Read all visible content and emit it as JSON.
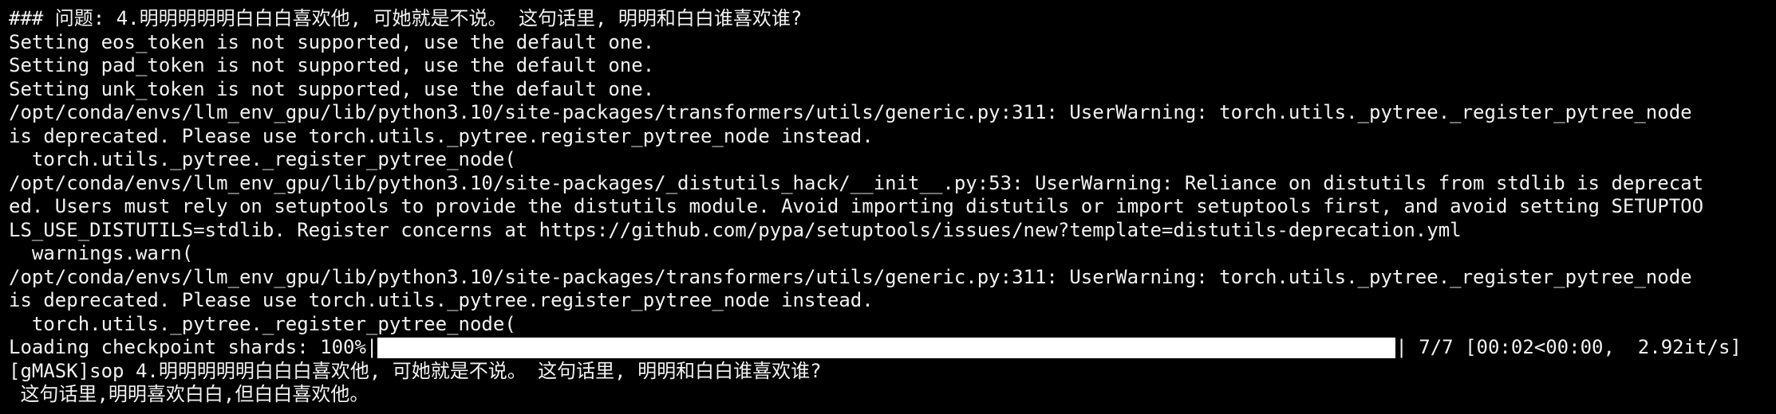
{
  "terminal": {
    "lines": [
      "### 问题: 4.明明明明明白白白喜欢他, 可她就是不说。 这句话里, 明明和白白谁喜欢谁?",
      "Setting eos_token is not supported, use the default one.",
      "Setting pad_token is not supported, use the default one.",
      "Setting unk_token is not supported, use the default one.",
      "/opt/conda/envs/llm_env_gpu/lib/python3.10/site-packages/transformers/utils/generic.py:311: UserWarning: torch.utils._pytree._register_pytree_node",
      "is deprecated. Please use torch.utils._pytree.register_pytree_node instead.",
      "  torch.utils._pytree._register_pytree_node(",
      "/opt/conda/envs/llm_env_gpu/lib/python3.10/site-packages/_distutils_hack/__init__.py:53: UserWarning: Reliance on distutils from stdlib is deprecat",
      "ed. Users must rely on setuptools to provide the distutils module. Avoid importing distutils or import setuptools first, and avoid setting SETUPTOO",
      "LS_USE_DISTUTILS=stdlib. Register concerns at https://github.com/pypa/setuptools/issues/new?template=distutils-deprecation.yml",
      "  warnings.warn(",
      "/opt/conda/envs/llm_env_gpu/lib/python3.10/site-packages/transformers/utils/generic.py:311: UserWarning: torch.utils._pytree._register_pytree_node",
      "is deprecated. Please use torch.utils._pytree.register_pytree_node instead.",
      "  torch.utils._pytree._register_pytree_node("
    ],
    "progress": {
      "prefix": "Loading checkpoint shards: 100%|",
      "suffix": "| 7/7 [00:02<00:00,  2.92it/s]",
      "fraction": 1.0
    },
    "output_lines": [
      "[gMASK]sop 4.明明明明明白白白喜欢他, 可她就是不说。 这句话里, 明明和白白谁喜欢谁?",
      " 这句话里,明明喜欢白白,但白白喜欢他。"
    ]
  },
  "colors": {
    "background": "#000000",
    "text": "#f2f2f2",
    "progress_fill": "#ffffff"
  }
}
